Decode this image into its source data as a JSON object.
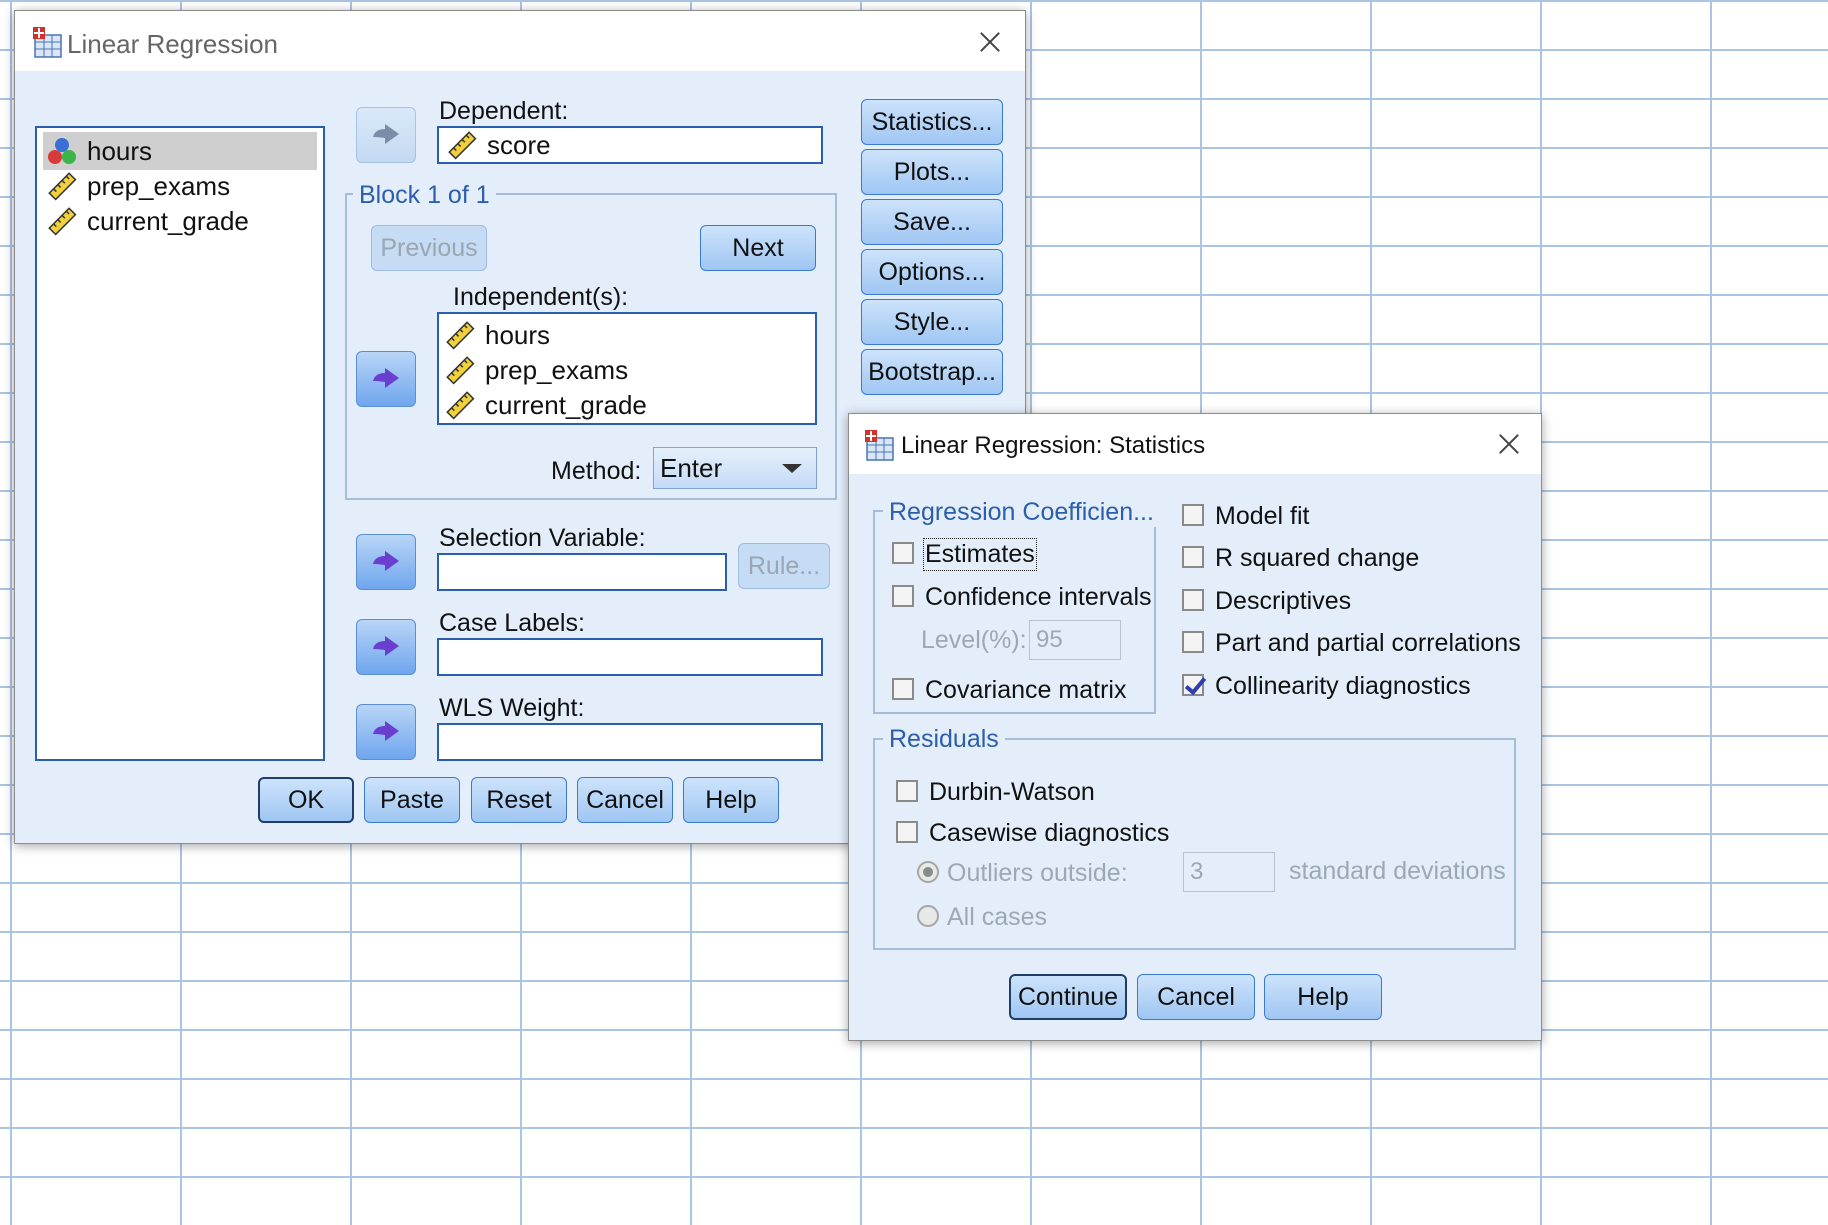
{
  "main_dialog": {
    "title": "Linear Regression",
    "variables": [
      {
        "name": "hours",
        "icon": "nominal-icon",
        "selected": true
      },
      {
        "name": "prep_exams",
        "icon": "scale-ruler-icon"
      },
      {
        "name": "current_grade",
        "icon": "scale-ruler-icon"
      }
    ],
    "dependent_label": "Dependent:",
    "dependent_value": "score",
    "block_label": "Block 1 of 1",
    "previous_label": "Previous",
    "next_label": "Next",
    "independents_label": "Independent(s):",
    "independents": [
      "hours",
      "prep_exams",
      "current_grade"
    ],
    "method_label": "Method:",
    "method_value": "Enter",
    "selection_label": "Selection Variable:",
    "rule_label": "Rule...",
    "case_labels_label": "Case Labels:",
    "wls_label": "WLS Weight:",
    "side_buttons": [
      "Statistics...",
      "Plots...",
      "Save...",
      "Options...",
      "Style...",
      "Bootstrap..."
    ],
    "bottom_buttons": [
      "OK",
      "Paste",
      "Reset",
      "Cancel",
      "Help"
    ]
  },
  "stats_dialog": {
    "title": "Linear Regression: Statistics",
    "coef_group": "Regression Coefficien...",
    "estimates": "Estimates",
    "confidence": "Confidence intervals",
    "level_label": "Level(%):",
    "level_value": "95",
    "covariance": "Covariance matrix",
    "right_options": [
      {
        "label": "Model fit",
        "checked": false
      },
      {
        "label": "R squared change",
        "checked": false
      },
      {
        "label": "Descriptives",
        "checked": false
      },
      {
        "label": "Part and partial correlations",
        "checked": false
      },
      {
        "label": "Collinearity diagnostics",
        "checked": true
      }
    ],
    "residuals_group": "Residuals",
    "durbin": "Durbin-Watson",
    "casewise": "Casewise diagnostics",
    "outliers": "Outliers outside:",
    "outliers_value": "3",
    "std_dev": "standard deviations",
    "all_cases": "All cases",
    "buttons": [
      "Continue",
      "Cancel",
      "Help"
    ]
  }
}
